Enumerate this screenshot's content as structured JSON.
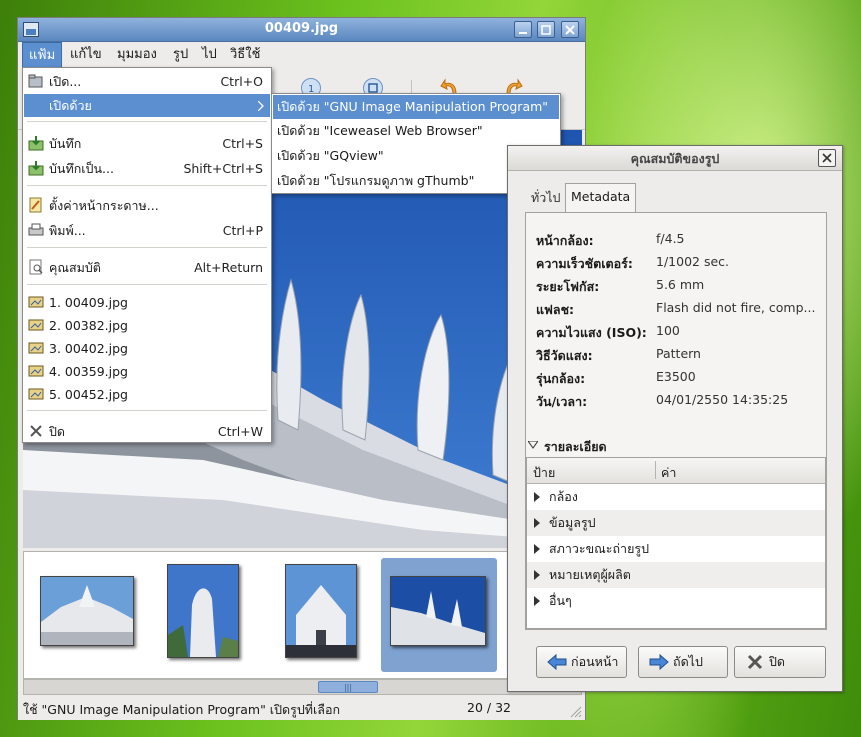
{
  "window": {
    "title": "00409.jpg"
  },
  "menubar": {
    "items": [
      "แฟ้ม",
      "แก้ไข",
      "มุมมอง",
      "รูป",
      "ไป",
      "วิธีใช้"
    ]
  },
  "file_menu": {
    "items": [
      {
        "label": "เปิด...",
        "accel": "Ctrl+O"
      },
      {
        "label": "เปิดด้วย",
        "accel": ""
      },
      {
        "label": "บันทึก",
        "accel": "Ctrl+S"
      },
      {
        "label": "บันทึกเป็น...",
        "accel": "Shift+Ctrl+S"
      },
      {
        "label": "ตั้งค่าหน้ากระดาษ...",
        "accel": ""
      },
      {
        "label": "พิมพ์...",
        "accel": "Ctrl+P"
      },
      {
        "label": "คุณสมบัติ",
        "accel": "Alt+Return"
      },
      {
        "label": "1. 00409.jpg",
        "accel": ""
      },
      {
        "label": "2. 00382.jpg",
        "accel": ""
      },
      {
        "label": "3. 00402.jpg",
        "accel": ""
      },
      {
        "label": "4. 00359.jpg",
        "accel": ""
      },
      {
        "label": "5. 00452.jpg",
        "accel": ""
      },
      {
        "label": "ปิด",
        "accel": "Ctrl+W"
      }
    ]
  },
  "open_with_submenu": {
    "items": [
      "เปิดด้วย \"GNU Image Manipulation Program\"",
      "เปิดด้วย \"Iceweasel Web Browser\"",
      "เปิดด้วย \"GQview\"",
      "เปิดด้วย \"โปรแกรมดูภาพ gThumb\""
    ]
  },
  "statusbar": {
    "message": "ใช้ \"GNU Image Manipulation Program\" เปิดรูปที่เลือก",
    "position": "20 / 32"
  },
  "properties": {
    "title": "คุณสมบัติของรูป",
    "tabs": [
      "ทั่วไป",
      "Metadata"
    ],
    "fields": [
      {
        "key": "หน้ากล้อง:",
        "value": "f/4.5"
      },
      {
        "key": "ความเร็วชัตเตอร์:",
        "value": "1/1002 sec."
      },
      {
        "key": "ระยะโฟกัส:",
        "value": "5.6 mm"
      },
      {
        "key": "แฟลช:",
        "value": "Flash did not fire, comp..."
      },
      {
        "key": "ความไวแสง (ISO):",
        "value": "100"
      },
      {
        "key": "วิธีวัดแสง:",
        "value": "Pattern"
      },
      {
        "key": "รุ่นกล้อง:",
        "value": "E3500"
      },
      {
        "key": "วัน/เวลา:",
        "value": "04/01/2550  14:35:25"
      }
    ],
    "details_label": "รายละเอียด",
    "columns": [
      "ป้าย",
      "ค่า"
    ],
    "tree": [
      "กล้อง",
      "ข้อมูลรูป",
      "สภาวะขณะถ่ายรูป",
      "หมายเหตุผู้ผลิต",
      "อื่นๆ"
    ],
    "buttons": {
      "prev": "ก่อนหน้า",
      "next": "ถัดไป",
      "close": "ปิด"
    }
  },
  "colors": {
    "selection": "#5b8fd0",
    "titlebar": "#5b87c0",
    "sky": "#2a61b8"
  }
}
